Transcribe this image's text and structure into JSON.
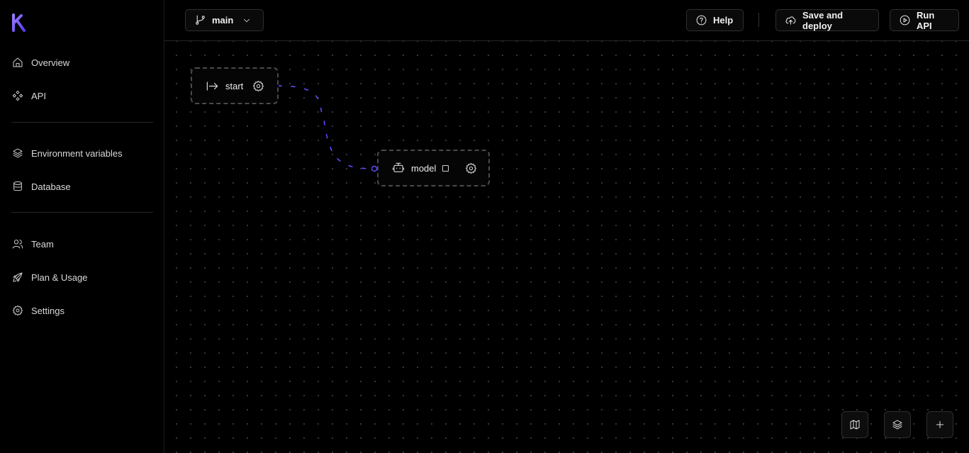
{
  "sidebar": {
    "logo_icon": "k-logo-icon",
    "brand_color": "#7c5cff",
    "items": [
      {
        "label": "Overview",
        "icon": "home-icon"
      },
      {
        "label": "API",
        "icon": "api-icon"
      },
      {
        "label": "Environment variables",
        "icon": "layers-icon"
      },
      {
        "label": "Database",
        "icon": "database-icon"
      },
      {
        "label": "Team",
        "icon": "users-icon"
      },
      {
        "label": "Plan & Usage",
        "icon": "rocket-icon"
      },
      {
        "label": "Settings",
        "icon": "gear-icon"
      }
    ]
  },
  "topbar": {
    "branch": {
      "label": "main",
      "icon": "git-branch-icon"
    },
    "help_label": "Help",
    "save_deploy_label": "Save and deploy",
    "run_api_label": "Run API"
  },
  "canvas": {
    "edge_color": "#5b4cff",
    "nodes": [
      {
        "label": "start",
        "icon": "arrow-right-to-line-icon"
      },
      {
        "label": "model",
        "icon": "robot-icon"
      }
    ]
  },
  "controls": [
    "map-icon",
    "layers-icon",
    "plus-icon"
  ]
}
